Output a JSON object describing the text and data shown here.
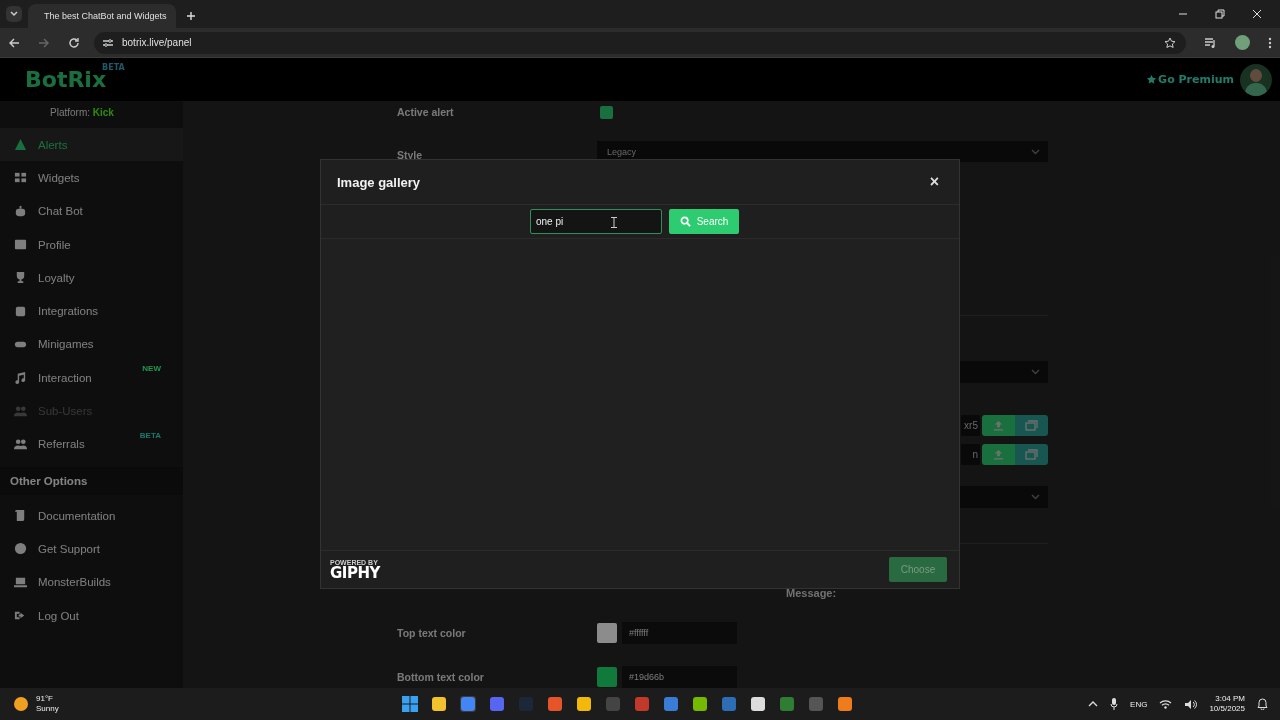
{
  "browser": {
    "tab_title": "The best ChatBot and Widgets",
    "url": "botrix.live/panel"
  },
  "header": {
    "logo": "BotRix",
    "logo_badge": "BETA",
    "premium": "Go Premium"
  },
  "sidebar": {
    "platform_label": "Platform:",
    "platform": "Kick",
    "items": [
      {
        "label": "Alerts",
        "selected": true,
        "disabled": false
      },
      {
        "label": "Widgets",
        "selected": false,
        "disabled": false
      },
      {
        "label": "Chat Bot",
        "selected": false,
        "disabled": false
      },
      {
        "label": "Profile",
        "selected": false,
        "disabled": false
      },
      {
        "label": "Loyalty",
        "selected": false,
        "disabled": false
      },
      {
        "label": "Integrations",
        "selected": false,
        "disabled": false
      },
      {
        "label": "Minigames",
        "selected": false,
        "disabled": false
      },
      {
        "label": "Interaction",
        "selected": false,
        "disabled": false,
        "badge": {
          "text": "NEW",
          "color": "#1a9a4f"
        }
      },
      {
        "label": "Sub-Users",
        "selected": false,
        "disabled": true
      },
      {
        "label": "Referrals",
        "selected": false,
        "disabled": false,
        "badge": {
          "text": "BETA",
          "color": "#1a7a72"
        }
      }
    ],
    "section": "Other Options",
    "other_items": [
      {
        "label": "Documentation"
      },
      {
        "label": "Get Support"
      },
      {
        "label": "MonsterBuilds"
      },
      {
        "label": "Log Out"
      }
    ]
  },
  "form": {
    "active_alert": {
      "label": "Active alert",
      "checked": true
    },
    "style": {
      "label": "Style",
      "value": "Legacy"
    },
    "file_fields": [
      "xr5",
      "n"
    ],
    "message_label": "Message:",
    "colors": [
      {
        "label": "Top text color",
        "color": "#8c8c8c",
        "value": "#ffffff"
      },
      {
        "label": "Bottom text color",
        "color": "#0f7a3b",
        "value": "#19d66b"
      }
    ]
  },
  "modal": {
    "title": "Image gallery",
    "close": "×",
    "search_value": "one pi",
    "search_button": "Search",
    "powered_by": "POWERED BY",
    "giphy": "GIPHY",
    "choose": "Choose",
    "choose_disabled": true
  },
  "taskbar": {
    "temperature": "91°F",
    "weather": "Sunny",
    "language": "ENG",
    "time": "3:04 PM",
    "date": "10/5/2025"
  }
}
